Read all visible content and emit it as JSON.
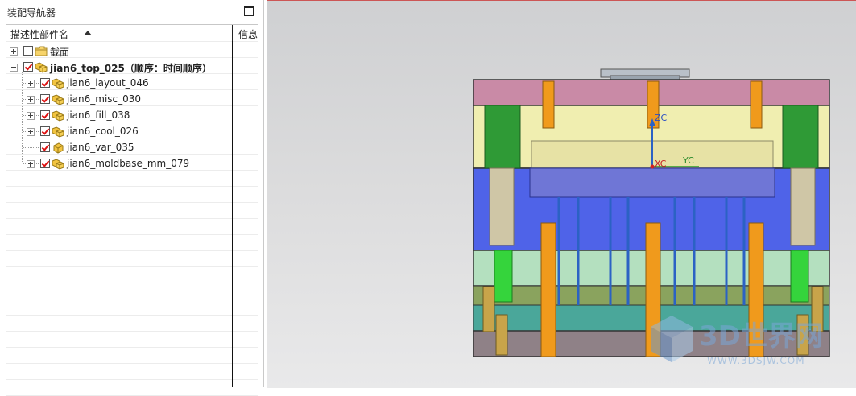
{
  "navigator": {
    "title": "装配导航器",
    "columns": {
      "description": "描述性部件名",
      "info": "信息"
    },
    "tree": [
      {
        "label": "截面",
        "bold": false,
        "checked": false,
        "icon": "folder-icon",
        "expander": "plus",
        "level": 0
      },
      {
        "label": "jian6_top_025（顺序：时间顺序）",
        "bold": true,
        "checked": true,
        "icon": "assembly-icon",
        "expander": "minus",
        "level": 0
      },
      {
        "label": "jian6_layout_046",
        "bold": false,
        "checked": true,
        "icon": "assembly-icon",
        "expander": "plus",
        "level": 1
      },
      {
        "label": "jian6_misc_030",
        "bold": false,
        "checked": true,
        "icon": "assembly-icon",
        "expander": "plus",
        "level": 1
      },
      {
        "label": "jian6_fill_038",
        "bold": false,
        "checked": true,
        "icon": "assembly-icon",
        "expander": "plus",
        "level": 1
      },
      {
        "label": "jian6_cool_026",
        "bold": false,
        "checked": true,
        "icon": "assembly-icon",
        "expander": "plus",
        "level": 1
      },
      {
        "label": "jian6_var_035",
        "bold": false,
        "checked": true,
        "icon": "part-icon",
        "expander": "none",
        "level": 1
      },
      {
        "label": "jian6_moldbase_mm_079",
        "bold": false,
        "checked": true,
        "icon": "assembly-icon",
        "expander": "plus",
        "level": 1
      }
    ]
  },
  "viewport": {
    "axis_labels": {
      "z": "ZC",
      "x": "XC",
      "y": "YC"
    },
    "colors": {
      "top_plate": "#c98aa6",
      "cavity_plate": "#f0eeb0",
      "core_plate": "#4f63e8",
      "support_block": "#b4e0bf",
      "ejector_plate": "#8aa35e",
      "ejector_retainer": "#4aa79a",
      "bottom_plate": "#8f8187",
      "leader_pin": "#f0a020",
      "guide_pillar": "#2fa33a"
    }
  },
  "watermark": {
    "main": "3D世界网",
    "sub": "WWW.3DSJW.COM"
  }
}
